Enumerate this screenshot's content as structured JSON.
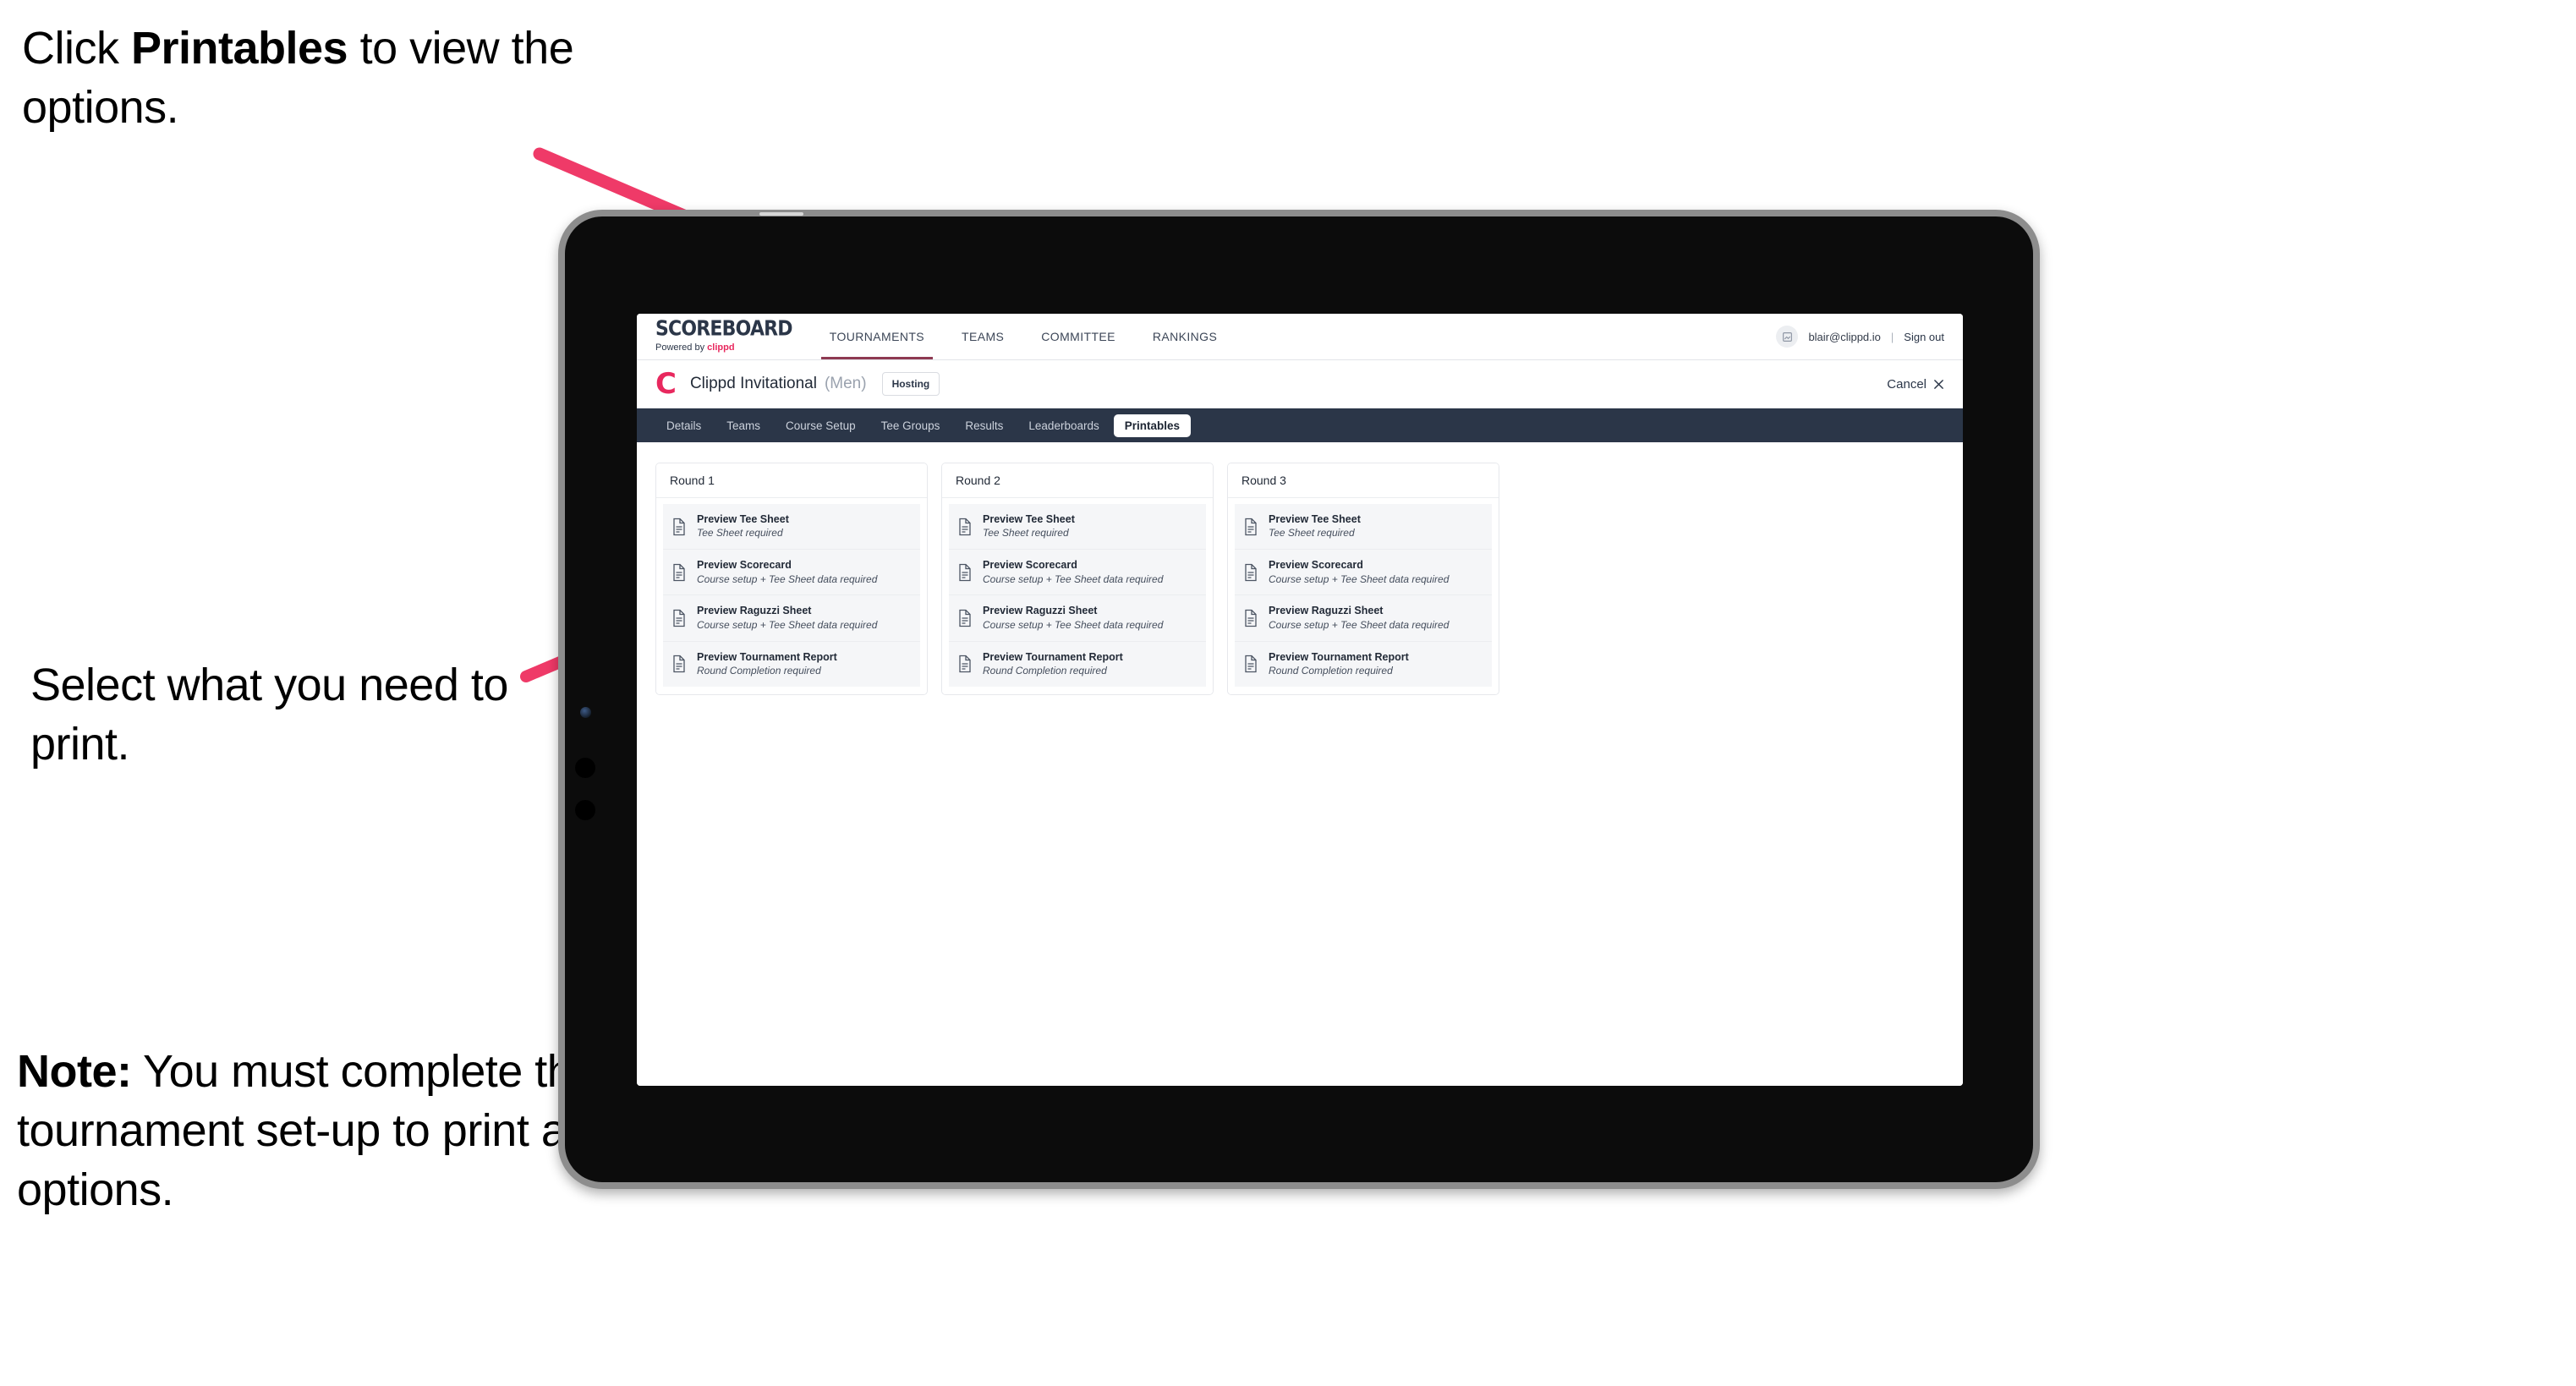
{
  "annotations": {
    "step1": {
      "pre": "Click ",
      "bold": "Printables",
      "post": " to view the options."
    },
    "step2": {
      "text": "Select what you need to print."
    },
    "note": {
      "bold": "Note:",
      "text": " You must complete the tournament set-up to print all the options."
    }
  },
  "colors": {
    "accent_pink": "#e8285e",
    "arrow_pink": "#ef3a68",
    "navy": "#2b3648",
    "tab_active_bg": "#ffffff",
    "card_item_bg": "#f5f6f8",
    "tablet_body": "#0c0c0c",
    "tablet_frame": "#8d8d8d"
  },
  "app": {
    "brand": {
      "title": "SCOREBOARD",
      "sub_pre": "Powered by ",
      "sub_brand": "clippd"
    },
    "nav_links": [
      {
        "label": "TOURNAMENTS",
        "active": true
      },
      {
        "label": "TEAMS",
        "active": false
      },
      {
        "label": "COMMITTEE",
        "active": false
      },
      {
        "label": "RANKINGS",
        "active": false
      }
    ],
    "account": {
      "avatar_icon": "user-avatar-icon",
      "email": "blair@clippd.io",
      "separator": "|",
      "sign_out": "Sign out"
    },
    "tournament_bar": {
      "logo_letter": "C",
      "name": "Clippd Invitational",
      "gender": "(Men)",
      "status_badge": "Hosting",
      "cancel_label": "Cancel",
      "cancel_icon": "close-x-icon"
    },
    "tabs": [
      {
        "label": "Details",
        "active": false
      },
      {
        "label": "Teams",
        "active": false
      },
      {
        "label": "Course Setup",
        "active": false
      },
      {
        "label": "Tee Groups",
        "active": false
      },
      {
        "label": "Results",
        "active": false
      },
      {
        "label": "Leaderboards",
        "active": false
      },
      {
        "label": "Printables",
        "active": true
      }
    ],
    "rounds": [
      {
        "header": "Round 1",
        "items": [
          {
            "icon": "document-icon",
            "title": "Preview Tee Sheet",
            "subtitle": "Tee Sheet required"
          },
          {
            "icon": "document-icon",
            "title": "Preview Scorecard",
            "subtitle": "Course setup + Tee Sheet data required"
          },
          {
            "icon": "document-icon",
            "title": "Preview Raguzzi Sheet",
            "subtitle": "Course setup + Tee Sheet data required"
          },
          {
            "icon": "document-icon",
            "title": "Preview Tournament Report",
            "subtitle": "Round Completion required"
          }
        ]
      },
      {
        "header": "Round 2",
        "items": [
          {
            "icon": "document-icon",
            "title": "Preview Tee Sheet",
            "subtitle": "Tee Sheet required"
          },
          {
            "icon": "document-icon",
            "title": "Preview Scorecard",
            "subtitle": "Course setup + Tee Sheet data required"
          },
          {
            "icon": "document-icon",
            "title": "Preview Raguzzi Sheet",
            "subtitle": "Course setup + Tee Sheet data required"
          },
          {
            "icon": "document-icon",
            "title": "Preview Tournament Report",
            "subtitle": "Round Completion required"
          }
        ]
      },
      {
        "header": "Round 3",
        "items": [
          {
            "icon": "document-icon",
            "title": "Preview Tee Sheet",
            "subtitle": "Tee Sheet required"
          },
          {
            "icon": "document-icon",
            "title": "Preview Scorecard",
            "subtitle": "Course setup + Tee Sheet data required"
          },
          {
            "icon": "document-icon",
            "title": "Preview Raguzzi Sheet",
            "subtitle": "Course setup + Tee Sheet data required"
          },
          {
            "icon": "document-icon",
            "title": "Preview Tournament Report",
            "subtitle": "Round Completion required"
          }
        ]
      }
    ]
  }
}
